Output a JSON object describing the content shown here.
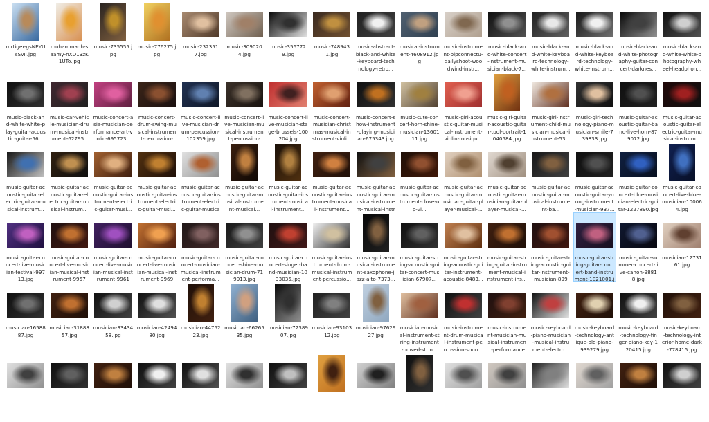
{
  "selected_index": 61,
  "files": [
    {
      "name": "mrtiger-gsNEYUsSvII.jpg",
      "colors": [
        "#c8ddf0",
        "#b88a5a",
        "#3a6aa0"
      ],
      "shape": "portrait"
    },
    {
      "name": "muhammadh-saamy-nXD13zK1UTo.jpg",
      "colors": [
        "#f0ede6",
        "#e8a030",
        "#d89050"
      ],
      "shape": "portrait"
    },
    {
      "name": "music-735555.jpg",
      "colors": [
        "#2a2420",
        "#c0902a",
        "#806040"
      ],
      "shape": "portrait"
    },
    {
      "name": "music-776275.jpg",
      "colors": [
        "#f0d060",
        "#e09030",
        "#b07020"
      ],
      "shape": "portrait"
    },
    {
      "name": "music-2323517.jpg",
      "colors": [
        "#a88a70",
        "#e0c0a0",
        "#503a2a"
      ],
      "shape": "landscape"
    },
    {
      "name": "music-3090204.jpg",
      "colors": [
        "#d0c8c0",
        "#a08068",
        "#706050"
      ],
      "shape": "landscape"
    },
    {
      "name": "music-3567729.jpg",
      "colors": [
        "#0a0a0a",
        "#303030",
        "#e0e0e0"
      ],
      "shape": "landscape"
    },
    {
      "name": "music-7489431.jpg",
      "colors": [
        "#3a2a20",
        "#c09040",
        "#705030"
      ],
      "shape": "landscape"
    },
    {
      "name": "music-abstract-black-and-white-keyboard-technology-retro...",
      "colors": [
        "#202020",
        "#f0f0f0",
        "#404040"
      ],
      "shape": "landscape"
    },
    {
      "name": "musical-instrument-4608912.jpg",
      "colors": [
        "#506070",
        "#c0a080",
        "#304050"
      ],
      "shape": "landscape"
    },
    {
      "name": "music-instrument-plpconnectu-dailyshoot-woodwind-instr...",
      "colors": [
        "#d8d0c8",
        "#806850",
        "#b0a090"
      ],
      "shape": "landscape"
    },
    {
      "name": "music-black-and-white-concert-instrument-musician-black-7...",
      "colors": [
        "#101010",
        "#909090",
        "#505050"
      ],
      "shape": "landscape"
    },
    {
      "name": "music-black-and-white-keyboard-technology-white-instrum...",
      "colors": [
        "#202020",
        "#e8e8e8",
        "#606060"
      ],
      "shape": "landscape"
    },
    {
      "name": "music-black-and-white-keyboard-technology-white-instrum...",
      "colors": [
        "#181818",
        "#f0f0f0",
        "#707070"
      ],
      "shape": "landscape"
    },
    {
      "name": "music-black-and-white-photography-guitar-concert-darknes...",
      "colors": [
        "#080808",
        "#404040",
        "#909090"
      ],
      "shape": "landscape"
    },
    {
      "name": "music-black-and-white-white-photography-wheel-headphon...",
      "colors": [
        "#101010",
        "#d0d0d0",
        "#505050"
      ],
      "shape": "landscape"
    },
    {
      "name": "music-black-and-white-white-play-guitar-acoustic-guitar-56...",
      "colors": [
        "#101010",
        "#707070",
        "#303030"
      ],
      "shape": "landscape"
    },
    {
      "name": "music-car-vehicle-musician-drum-musical-instrument-62795...",
      "colors": [
        "#402830",
        "#a04050",
        "#202020"
      ],
      "shape": "landscape"
    },
    {
      "name": "music-concert-asia-musician-performance-art-violin-695723...",
      "colors": [
        "#c04080",
        "#e060a0",
        "#602040"
      ],
      "shape": "landscape"
    },
    {
      "name": "music-concert-drum-swing-musical-instrument-percussion-6...",
      "colors": [
        "#3a2418",
        "#8a5030",
        "#1a1010"
      ],
      "shape": "landscape"
    },
    {
      "name": "music-concert-live-musician-drum-percussion-102359.jpg",
      "colors": [
        "#203050",
        "#6080b0",
        "#101828"
      ],
      "shape": "landscape"
    },
    {
      "name": "music-concert-live-musician-musical-instrument-percussion-1...",
      "colors": [
        "#3a3028",
        "#807060",
        "#1a1410"
      ],
      "shape": "landscape"
    },
    {
      "name": "music-concert-live-musician-stage-brussels-100204.jpg",
      "colors": [
        "#c03030",
        "#402020",
        "#e08070"
      ],
      "shape": "landscape"
    },
    {
      "name": "music-concert-musician-christmas-musical-instrument-violi...",
      "colors": [
        "#c06030",
        "#e0a070",
        "#602010"
      ],
      "shape": "landscape"
    },
    {
      "name": "music-concert-show-instrument-playing-musician-675343.jpg",
      "colors": [
        "#101010",
        "#c07020",
        "#303030"
      ],
      "shape": "landscape"
    },
    {
      "name": "music-cute-concert-horn-shine-musician-1360111.jpg",
      "colors": [
        "#d0c0a0",
        "#a08040",
        "#504030"
      ],
      "shape": "landscape"
    },
    {
      "name": "music-girl-acoustic-guitar-musical-instrument-violin-musiqu...",
      "colors": [
        "#e06050",
        "#f0a090",
        "#a03030"
      ],
      "shape": "landscape"
    },
    {
      "name": "music-girl-guitar-acoustic-guitar-tool-portrait-1040584.jpg",
      "colors": [
        "#e0a040",
        "#c06020",
        "#703010"
      ],
      "shape": "portrait"
    },
    {
      "name": "music-girl-instrument-child-musician-musical-instrument-53...",
      "colors": [
        "#f0e8e0",
        "#b07040",
        "#603020"
      ],
      "shape": "landscape"
    },
    {
      "name": "music-girl-technology-piano-musician-smile-739833.jpg",
      "colors": [
        "#303030",
        "#e0c0a0",
        "#101010"
      ],
      "shape": "landscape"
    },
    {
      "name": "music-guitar-acoustic-guitar-band-live-horn-879072.jpg",
      "colors": [
        "#101010",
        "#505050",
        "#202020"
      ],
      "shape": "landscape"
    },
    {
      "name": "music-guitar-acoustic-guitar-electric-guitar-musical-instrum...",
      "colors": [
        "#200808",
        "#a02020",
        "#101010"
      ],
      "shape": "landscape"
    },
    {
      "name": "music-guitar-acoustic-guitar-electric-guitar-musical-instrum...",
      "colors": [
        "#181818",
        "#4070b0",
        "#c0c0c0"
      ],
      "shape": "landscape"
    },
    {
      "name": "music-guitar-acoustic-guitar-electric-guitar-musical-instrum...",
      "colors": [
        "#302010",
        "#c09050",
        "#101010"
      ],
      "shape": "landscape"
    },
    {
      "name": "music-guitar-acoustic-guitar-instrument-electric-guitar-musi...",
      "colors": [
        "#a06030",
        "#e0b080",
        "#402010"
      ],
      "shape": "landscape"
    },
    {
      "name": "music-guitar-acoustic-guitar-instrument-electric-guitar-musi...",
      "colors": [
        "#503010",
        "#c08030",
        "#201008"
      ],
      "shape": "landscape"
    },
    {
      "name": "music-guitar-acoustic-guitar-instrument-electric-guitar-musical...",
      "colors": [
        "#e0e0e0",
        "#b06030",
        "#909090"
      ],
      "shape": "landscape"
    },
    {
      "name": "music-guitar-acoustic-guitar-musical-instrument-musical...",
      "colors": [
        "#3a2010",
        "#c08040",
        "#100804"
      ],
      "shape": "portrait"
    },
    {
      "name": "music-guitar-acoustic-guitar-instrument-musical-instrument...",
      "colors": [
        "#1a1008",
        "#b08040",
        "#503010"
      ],
      "shape": "portrait"
    },
    {
      "name": "music-guitar-acoustic-guitar-instrument-musical-instrument...",
      "colors": [
        "#402010",
        "#d08040",
        "#201008"
      ],
      "shape": "landscape"
    },
    {
      "name": "music-guitar-acoustic-guitar-musical-instrument-musical-instrument-...",
      "colors": [
        "#101010",
        "#404040",
        "#806040"
      ],
      "shape": "landscape"
    },
    {
      "name": "music-guitar-acoustic-guitar-instrument-close-up-vi...",
      "colors": [
        "#201008",
        "#905030",
        "#401808"
      ],
      "shape": "landscape"
    },
    {
      "name": "music-guitar-acoustic-guitar-musician-guitar-player-musical-...",
      "colors": [
        "#e0d0c0",
        "#806040",
        "#b09070"
      ],
      "shape": "landscape"
    },
    {
      "name": "music-guitar-acoustic-guitar-musician-guitar-player-musical-...",
      "colors": [
        "#e0d8d0",
        "#504030",
        "#a09080"
      ],
      "shape": "landscape"
    },
    {
      "name": "music-guitar-acoustic-guitar-musical-instrument-ba...",
      "colors": [
        "#181818",
        "#806040",
        "#404040"
      ],
      "shape": "landscape"
    },
    {
      "name": "music-guitar-acoustic-guitar-young-instrument-musician-937...",
      "colors": [
        "#101010",
        "#505050",
        "#202020"
      ],
      "shape": "landscape"
    },
    {
      "name": "music-guitar-concert-blue-musician-electric-guitar-1227890.jpg",
      "colors": [
        "#102040",
        "#3060c0",
        "#081020"
      ],
      "shape": "landscape"
    },
    {
      "name": "music-guitar-concert-live-blue-musician-100064.jpg",
      "colors": [
        "#102050",
        "#4070c0",
        "#081028"
      ],
      "shape": "portrait"
    },
    {
      "name": "music-guitar-concert-live-musician-festival-99713.jpg",
      "colors": [
        "#503080",
        "#c060c0",
        "#201040"
      ],
      "shape": "landscape"
    },
    {
      "name": "music-guitar-concert-live-musician-musical-instrument-99575...",
      "colors": [
        "#201010",
        "#c07030",
        "#401810"
      ],
      "shape": "landscape"
    },
    {
      "name": "music-guitar-concert-live-musician-musical-instrument-99615...",
      "colors": [
        "#402060",
        "#a050c0",
        "#201030"
      ],
      "shape": "landscape"
    },
    {
      "name": "music-guitar-concert-live-musician-musical-instrument-99690...",
      "colors": [
        "#c07030",
        "#f0a050",
        "#502010"
      ],
      "shape": "landscape"
    },
    {
      "name": "music-guitar-concert-musician-musical-instrument-performa...",
      "colors": [
        "#201818",
        "#806060",
        "#402828"
      ],
      "shape": "landscape"
    },
    {
      "name": "music-guitar-concert-shine-musician-drum-719913.jpg",
      "colors": [
        "#181818",
        "#909090",
        "#404040"
      ],
      "shape": "landscape"
    },
    {
      "name": "music-guitar-concert-singer-band-musician-1033035.jpg",
      "colors": [
        "#201010",
        "#c04030",
        "#401818"
      ],
      "shape": "landscape"
    },
    {
      "name": "music-guitar-instrument-drum-musical-instrument-percussio...",
      "colors": [
        "#f0f0f0",
        "#d0c0a0",
        "#303030"
      ],
      "shape": "landscape"
    },
    {
      "name": "music-guitar-musical-instrument-saxophone-jazz-alto-7373...",
      "colors": [
        "#080808",
        "#806040",
        "#202020"
      ],
      "shape": "portrait"
    },
    {
      "name": "music-guitar-string-acoustic-guitar-concert-musician-67907...",
      "colors": [
        "#101010",
        "#606060",
        "#303030"
      ],
      "shape": "landscape"
    },
    {
      "name": "music-guitar-string-acoustic-guitar-instrument-acoustic-8483...",
      "colors": [
        "#c08050",
        "#e0c0a0",
        "#603010"
      ],
      "shape": "landscape"
    },
    {
      "name": "music-guitar-string-guitar-instrument-musical-instrument-ins...",
      "colors": [
        "#402010",
        "#c07030",
        "#201008"
      ],
      "shape": "landscape"
    },
    {
      "name": "music-guitar-string-acoustic-guitar-instrument-musician-8993...",
      "colors": [
        "#201010",
        "#a05030",
        "#401810"
      ],
      "shape": "landscape"
    },
    {
      "name": "music-guitar-string-guitar-concert-band-instrument-1021001.jpg",
      "colors": [
        "#302040",
        "#c06080",
        "#181020"
      ],
      "shape": "landscape"
    },
    {
      "name": "music-guitar-summer-concert-live-canon-98818.jpg",
      "colors": [
        "#101830",
        "#506090",
        "#080810"
      ],
      "shape": "landscape"
    },
    {
      "name": "musician-1273161.jpg",
      "colors": [
        "#e0d0c0",
        "#604030",
        "#a08070"
      ],
      "shape": "landscape"
    },
    {
      "name": "musician-1658887.jpg",
      "colors": [
        "#101010",
        "#707070",
        "#303030"
      ],
      "shape": "landscape"
    },
    {
      "name": "musician-3188857.jpg",
      "colors": [
        "#402010",
        "#c07030",
        "#201008"
      ],
      "shape": "landscape"
    },
    {
      "name": "musician-3343458.jpg",
      "colors": [
        "#101010",
        "#d0d0d0",
        "#404040"
      ],
      "shape": "landscape"
    },
    {
      "name": "musician-4249480.jpg",
      "colors": [
        "#101010",
        "#e0e0e0",
        "#505050"
      ],
      "shape": "landscape"
    },
    {
      "name": "musician-4475223.jpg",
      "colors": [
        "#201008",
        "#c08030",
        "#402010"
      ],
      "shape": "portrait"
    },
    {
      "name": "musician-6626535.jpg",
      "colors": [
        "#90b0d0",
        "#d0a080",
        "#406080"
      ],
      "shape": "portrait"
    },
    {
      "name": "musician-7238907.jpg",
      "colors": [
        "#0a0a0a",
        "#303030",
        "#909090"
      ],
      "shape": "portrait"
    },
    {
      "name": "musician-9310312.jpg",
      "colors": [
        "#202020",
        "#808080",
        "#404040"
      ],
      "shape": "landscape"
    },
    {
      "name": "musician-9762927.jpg",
      "colors": [
        "#c0d0e0",
        "#806040",
        "#90a8c0"
      ],
      "shape": "portrait"
    },
    {
      "name": "musician-musical-instrument-string-instrument-bowed-strin...",
      "colors": [
        "#e0c0a0",
        "#a06040",
        "#603020"
      ],
      "shape": "landscape"
    },
    {
      "name": "music-instrument-drum-musical-instrument-percussion-soun...",
      "colors": [
        "#101010",
        "#c03030",
        "#404040"
      ],
      "shape": "landscape"
    },
    {
      "name": "music-instrument-musician-musical-instrument-performance-...",
      "colors": [
        "#201010",
        "#804030",
        "#402010"
      ],
      "shape": "landscape"
    },
    {
      "name": "music-keyboard-piano-musician-musical-instrument-electro...",
      "colors": [
        "#101010",
        "#c04040",
        "#e0e0e0"
      ],
      "shape": "landscape"
    },
    {
      "name": "music-keyboard-technology-antique-old-piano-939279.jpg",
      "colors": [
        "#402010",
        "#e0d0b0",
        "#201008"
      ],
      "shape": "landscape"
    },
    {
      "name": "music-keyboard-technology-finger-piano-key-120415.jpg",
      "colors": [
        "#101010",
        "#f0f0f0",
        "#404040"
      ],
      "shape": "landscape"
    },
    {
      "name": "music-keyboard-technology-interior-home-dark-778415.jpg",
      "colors": [
        "#201008",
        "#806040",
        "#402010"
      ],
      "shape": "landscape"
    },
    {
      "name": "",
      "colors": [
        "#e0e0e0",
        "#404040",
        "#909090"
      ],
      "shape": "landscape"
    },
    {
      "name": "",
      "colors": [
        "#101010",
        "#606060",
        "#303030"
      ],
      "shape": "landscape"
    },
    {
      "name": "",
      "colors": [
        "#402010",
        "#c08040",
        "#201008"
      ],
      "shape": "landscape"
    },
    {
      "name": "",
      "colors": [
        "#101010",
        "#f0f0f0",
        "#404040"
      ],
      "shape": "landscape"
    },
    {
      "name": "",
      "colors": [
        "#101010",
        "#e0e0e0",
        "#505050"
      ],
      "shape": "landscape"
    },
    {
      "name": "",
      "colors": [
        "#e0e0e0",
        "#303030",
        "#909090"
      ],
      "shape": "landscape"
    },
    {
      "name": "",
      "colors": [
        "#101010",
        "#c0c0c0",
        "#404040"
      ],
      "shape": "landscape"
    },
    {
      "name": "",
      "colors": [
        "#e0a040",
        "#402010",
        "#c07020"
      ],
      "shape": "portrait"
    },
    {
      "name": "",
      "colors": [
        "#d0d0d0",
        "#202020",
        "#808080"
      ],
      "shape": "landscape"
    },
    {
      "name": "",
      "colors": [
        "#101010",
        "#806040",
        "#303030"
      ],
      "shape": "portrait"
    },
    {
      "name": "",
      "colors": [
        "#e0e0e0",
        "#505050",
        "#a0a0a0"
      ],
      "shape": "landscape"
    },
    {
      "name": "",
      "colors": [
        "#d0c8c0",
        "#404040",
        "#909090"
      ],
      "shape": "landscape"
    },
    {
      "name": "",
      "colors": [
        "#202020",
        "#808080",
        "#e0e0e0"
      ],
      "shape": "landscape"
    },
    {
      "name": "",
      "colors": [
        "#e0d8d0",
        "#606060",
        "#a0a0a0"
      ],
      "shape": "landscape"
    },
    {
      "name": "",
      "colors": [
        "#402010",
        "#c08040",
        "#201008"
      ],
      "shape": "landscape"
    },
    {
      "name": "",
      "colors": [
        "#101010",
        "#d0d0d0",
        "#404040"
      ],
      "shape": "landscape"
    }
  ]
}
